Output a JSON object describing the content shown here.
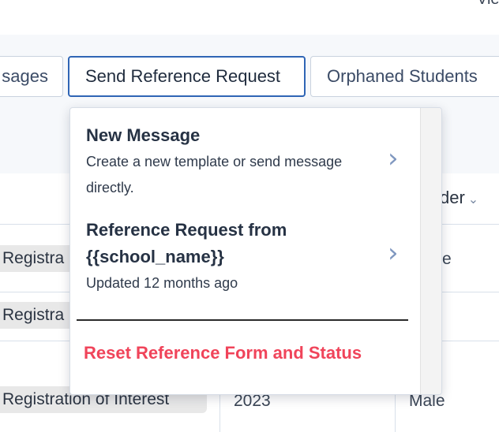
{
  "top": {
    "partial_text": "Vie"
  },
  "tabs": [
    {
      "label": "Messages",
      "visible": "sages"
    },
    {
      "label": "Send Reference Request"
    },
    {
      "label": "Orphaned Students"
    }
  ],
  "table": {
    "header_gender": "Gender",
    "header_gender_visible": "der",
    "rows": [
      {
        "status": "Registration of Interest",
        "status_visible": "Registra",
        "gender_partial": "e"
      },
      {
        "status": "Registration of Interest",
        "status_visible": "Registra",
        "gender_partial": ""
      },
      {
        "status": "Registration of Interest",
        "status_visible": "Registration of Interest",
        "year": "2023",
        "gender": "Male"
      }
    ]
  },
  "dropdown": {
    "items": [
      {
        "title": "New Message",
        "description_line1": "Create a new template or send message",
        "description_line2": "directly."
      },
      {
        "title_line1": "Reference Request from",
        "title_line2": "{{school_name}}",
        "description": "Updated 12 months ago"
      }
    ],
    "reset_label": "Reset Reference Form and Status"
  },
  "colors": {
    "accent": "#2f65b5",
    "danger": "#f0445a",
    "chevron": "#7f97bf"
  }
}
